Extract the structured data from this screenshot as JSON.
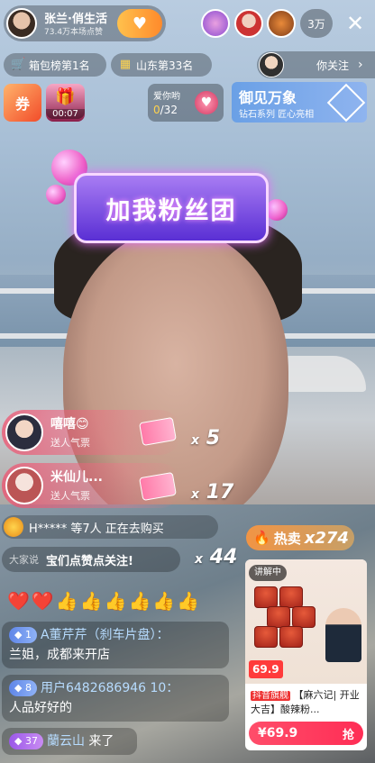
{
  "host": {
    "name": "张兰·俏生活",
    "likes": "73.4万本场点赞",
    "follow_icon": "plus-heart-icon"
  },
  "viewers": {
    "count": "3万"
  },
  "close_glyph": "✕",
  "badges": {
    "rank_bag": "箱包榜第1名",
    "rank_region": "山东第33名"
  },
  "following": {
    "text": "你关注",
    "chevron": "›"
  },
  "coupon": {
    "label": "券"
  },
  "timer": {
    "time": "00:07"
  },
  "love": {
    "title": "爱你哟",
    "current": "0",
    "total": "/32"
  },
  "promo": {
    "title": "御见万象",
    "subtitle": "钻石系列 匠心亮相"
  },
  "fan_sign": {
    "text": "加我粉丝团"
  },
  "gifts": [
    {
      "user": "嘻嘻😊",
      "action": "送人气票",
      "multiplier_x": "x",
      "multiplier": "5"
    },
    {
      "user": "米仙儿...",
      "action": "送人气票",
      "multiplier_x": "x",
      "multiplier": "17"
    }
  ],
  "buyers": {
    "text": "H***** 等7人 正在去购买"
  },
  "big_say": {
    "label": "大家说",
    "text": "宝们点赞点关注!",
    "multiplier_x": "x",
    "multiplier": "44"
  },
  "emoji_row": "❤️❤️👍👍👍👍👍👍",
  "chat": [
    {
      "level": "1",
      "user": "A董芹芹（刹车片盘）：",
      "message": "兰姐，成都来开店"
    },
    {
      "level": "8",
      "user": "用户6482686946 10：",
      "message": "人品好好的"
    },
    {
      "level": "37",
      "user": "蘭云山",
      "message": " 来了"
    }
  ],
  "hot_sale": {
    "label": "热卖",
    "x": "x",
    "count": "274"
  },
  "product": {
    "badge": "讲解中",
    "price_tag": "69.9",
    "tag1": "抖音旗舰",
    "title": "【麻六记| 开业大吉】酸辣粉...",
    "price": "¥69.9",
    "buy": "抢"
  },
  "colors": {
    "accent": "#ff2d55",
    "hot": "#ff8a2b",
    "level_blue": "#5f86e8"
  }
}
